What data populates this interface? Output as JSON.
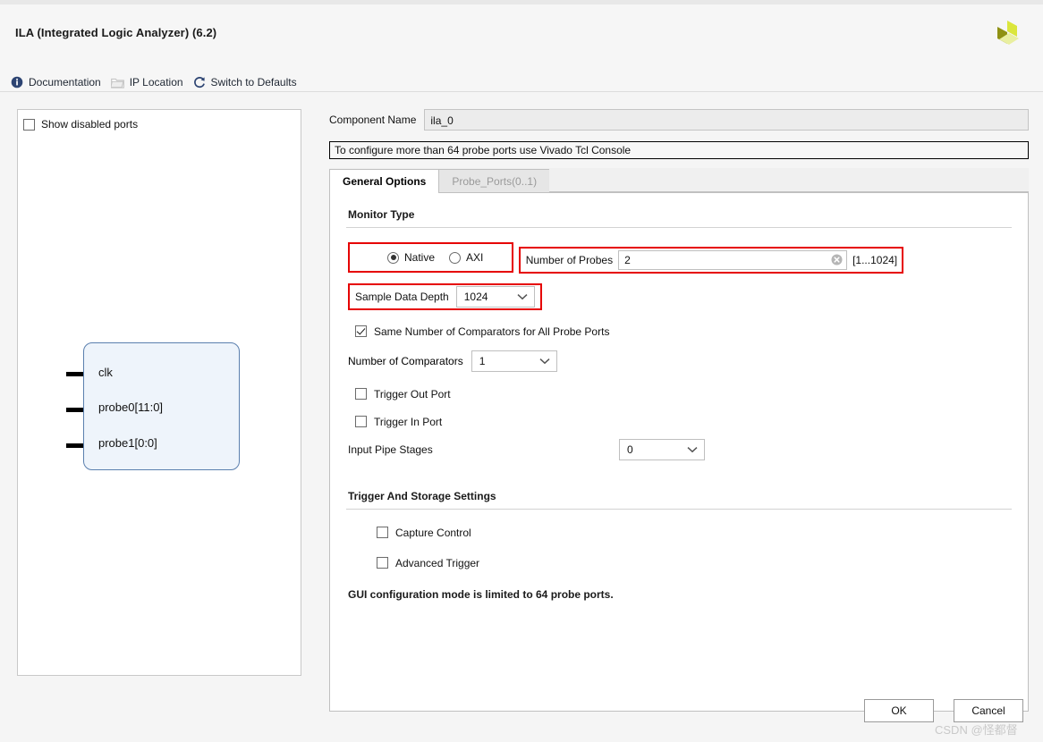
{
  "window": {
    "title": "ILA (Integrated Logic Analyzer) (6.2)"
  },
  "toolbar": {
    "items": [
      {
        "label": "Documentation",
        "icon": "info-icon"
      },
      {
        "label": "IP Location",
        "icon": "folder-icon"
      },
      {
        "label": "Switch to Defaults",
        "icon": "refresh-icon"
      }
    ]
  },
  "left_panel": {
    "show_disabled_ports_label": "Show disabled ports",
    "show_disabled_ports_checked": false,
    "symbol": {
      "ports": [
        "clk",
        "probe0[11:0]",
        "probe1[0:0]"
      ]
    }
  },
  "component": {
    "label": "Component Name",
    "value": "ila_0"
  },
  "warning": {
    "text": "To configure more than 64 probe ports use Vivado Tcl Console"
  },
  "tabs": [
    {
      "label": "General Options",
      "active": true,
      "disabled": false
    },
    {
      "label": "Probe_Ports(0..1)",
      "active": false,
      "disabled": true
    }
  ],
  "general_options": {
    "monitor_type": {
      "heading": "Monitor Type",
      "options": [
        {
          "label": "Native",
          "selected": true
        },
        {
          "label": "AXI",
          "selected": false
        }
      ]
    },
    "number_of_probes": {
      "label": "Number of Probes",
      "value": "2",
      "range_hint": "[1...1024]",
      "clear_icon": "clear-circle-icon"
    },
    "sample_data_depth": {
      "label": "Sample Data Depth",
      "value": "1024"
    },
    "same_number_comparators": {
      "label": "Same Number of Comparators for All Probe Ports",
      "checked": true
    },
    "number_of_comparators": {
      "label": "Number of Comparators",
      "value": "1"
    },
    "trigger_out_port": {
      "label": "Trigger Out Port",
      "checked": false
    },
    "trigger_in_port": {
      "label": "Trigger In Port",
      "checked": false
    },
    "input_pipe_stages": {
      "label": "Input Pipe Stages",
      "value": "0"
    },
    "trigger_storage": {
      "heading": "Trigger And Storage Settings",
      "capture_control": {
        "label": "Capture Control",
        "checked": false
      },
      "advanced_trigger": {
        "label": "Advanced Trigger",
        "checked": false
      }
    },
    "note": "GUI configuration mode is limited to 64 probe ports."
  },
  "footer": {
    "ok_label": "OK",
    "cancel_label": "Cancel"
  },
  "watermark": {
    "text": "CSDN @怪都督"
  },
  "colors": {
    "annotation_red": "#e60000",
    "logo_green": "#d6e03a",
    "symbol_fill": "#eef4fb",
    "symbol_border": "#5a7fae",
    "link_text": "#1f2733"
  }
}
